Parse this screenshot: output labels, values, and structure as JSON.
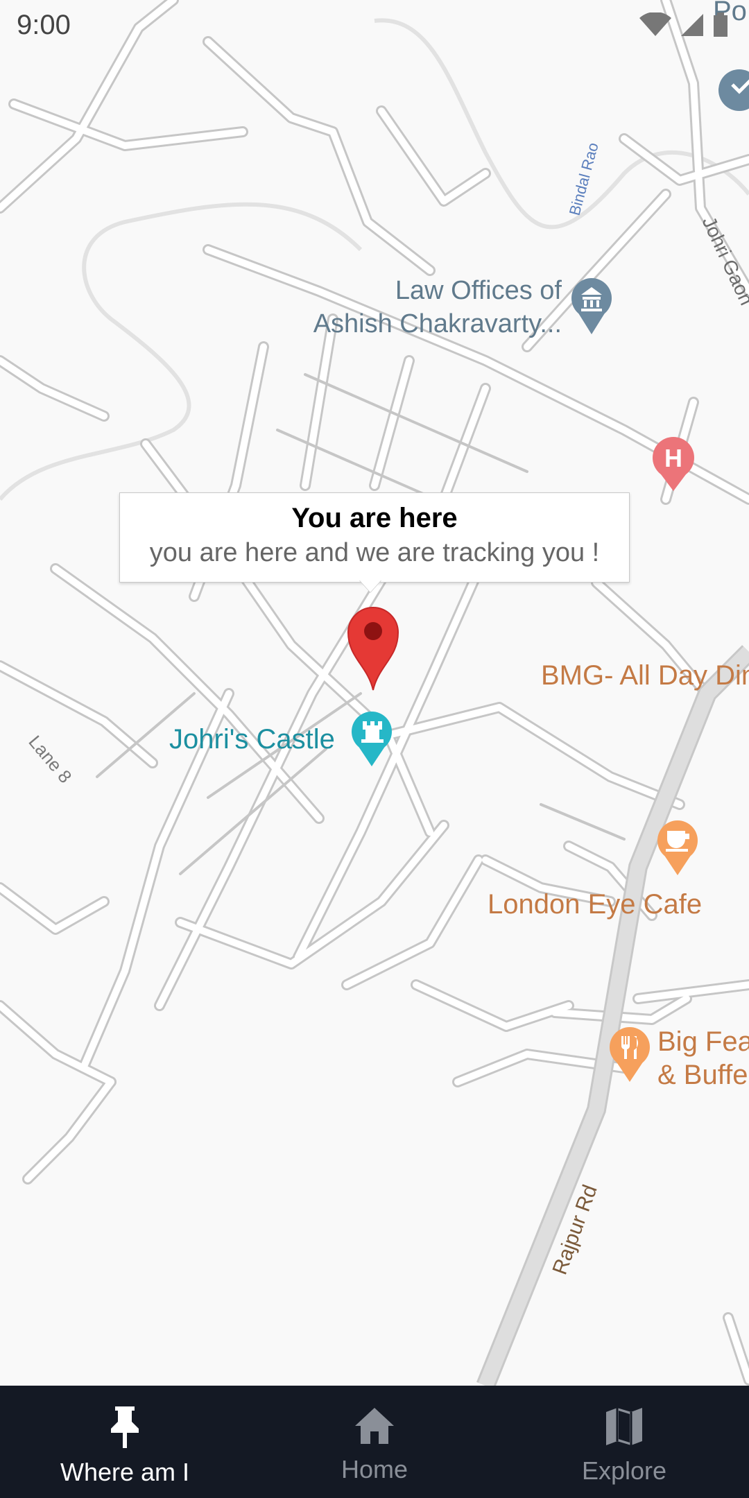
{
  "status_bar": {
    "time": "9:00"
  },
  "callout": {
    "title": "You are here",
    "subtitle": "you are here and we are tracking you !"
  },
  "map": {
    "places": [
      {
        "id": "law",
        "name_line1": "Law Offices of",
        "name_line2": "Ashish Chakravarty...",
        "icon": "courthouse-icon",
        "color": "#607a8c"
      },
      {
        "id": "castle",
        "name": "Johri's Castle",
        "icon": "castle-icon",
        "color": "#1b8fa0"
      },
      {
        "id": "bmg",
        "name": "BMG- All Day Din",
        "color": "#c47a45"
      },
      {
        "id": "cafe",
        "name": "London Eye Cafe",
        "icon": "cafe-icon",
        "color": "#c47a45"
      },
      {
        "id": "bigfeast",
        "name_line1": "Big Fea",
        "name_line2": "& Buffe",
        "icon": "restaurant-icon",
        "color": "#c47a45"
      },
      {
        "id": "hospital",
        "icon": "hospital-icon",
        "color": "#ec7479"
      },
      {
        "id": "po",
        "name": "Po",
        "icon": "post-office-icon",
        "color": "#607a8c"
      }
    ],
    "roads": [
      {
        "name": "Bindal Rao"
      },
      {
        "name": "Johri Gaon"
      },
      {
        "name": "Lane 8"
      },
      {
        "name": "Rajpur Rd"
      }
    ],
    "marker": {
      "icon": "location-pin-icon",
      "color": "#e53935"
    }
  },
  "bottom_nav": {
    "items": [
      {
        "label": "Where am I",
        "icon": "pin-icon",
        "active": true
      },
      {
        "label": "Home",
        "icon": "home-icon",
        "active": false
      },
      {
        "label": "Explore",
        "icon": "map-icon",
        "active": false
      }
    ]
  }
}
